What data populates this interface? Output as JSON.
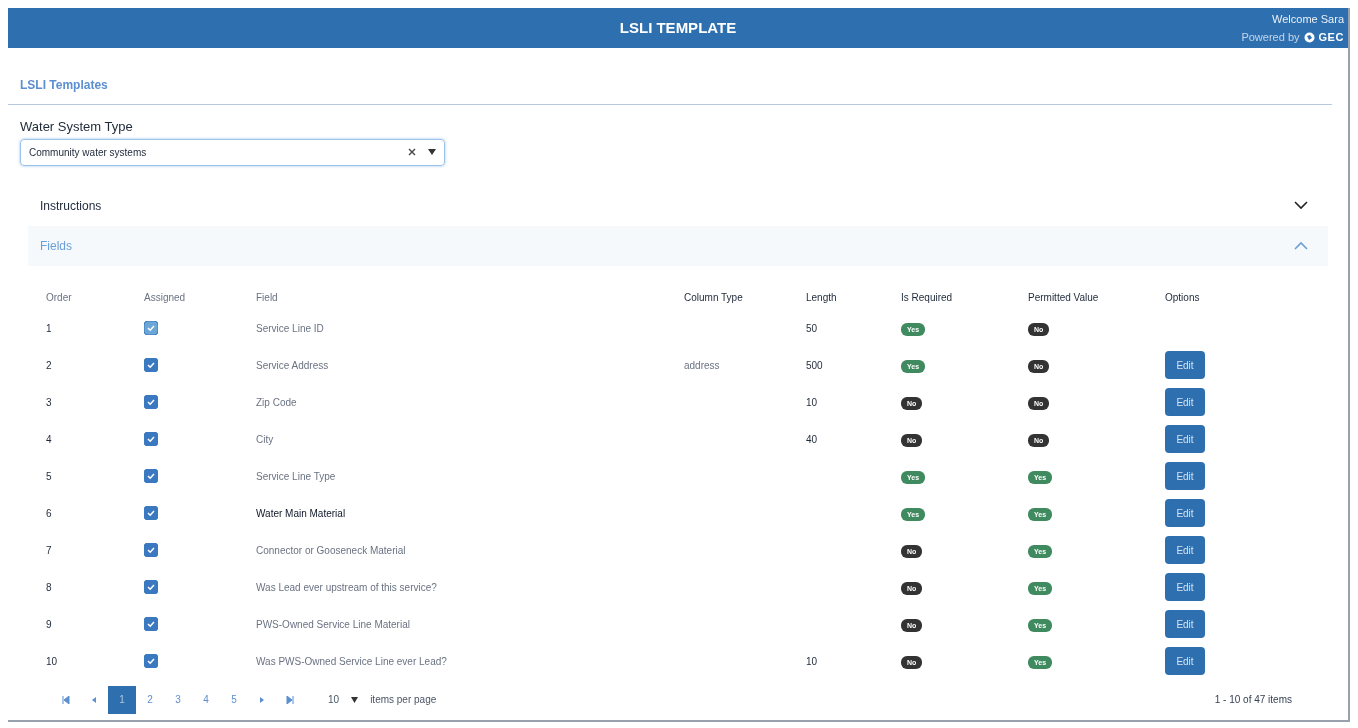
{
  "header": {
    "title": "LSLI TEMPLATE",
    "welcome": "Welcome Sara",
    "powered_by": "Powered by",
    "brand": "GEC"
  },
  "breadcrumb": "LSLI Templates",
  "water_system_type": {
    "label": "Water System Type",
    "value": "Community water systems"
  },
  "panels": [
    {
      "title": "Instructions",
      "expanded": false
    },
    {
      "title": "Fields",
      "expanded": true
    }
  ],
  "table": {
    "columns": [
      "Order",
      "Assigned",
      "Field",
      "Column Type",
      "Length",
      "Is Required",
      "Permitted Value",
      "Options"
    ],
    "rows": [
      {
        "order": "1",
        "assigned": true,
        "disabled": true,
        "field": "Service Line ID",
        "length": "50",
        "required": {
          "label": "Yes",
          "on": true
        },
        "permitted": {
          "label": "No",
          "on": false
        }
      },
      {
        "order": "2",
        "assigned": true,
        "disabled": false,
        "field": "Service Address",
        "column_type": "address",
        "length": "500",
        "required": {
          "label": "Yes",
          "on": true
        },
        "permitted": {
          "label": "No",
          "on": false
        },
        "edit": "Edit"
      },
      {
        "order": "3",
        "assigned": true,
        "disabled": false,
        "field": "Zip Code",
        "length": "10",
        "required": {
          "label": "No",
          "on": false
        },
        "permitted": {
          "label": "No",
          "on": false
        },
        "edit": "Edit"
      },
      {
        "order": "4",
        "assigned": true,
        "disabled": false,
        "field": "City",
        "length": "40",
        "required": {
          "label": "No",
          "on": false
        },
        "permitted": {
          "label": "No",
          "on": false
        },
        "edit": "Edit"
      },
      {
        "order": "5",
        "assigned": true,
        "disabled": false,
        "field": "Service Line Type",
        "required": {
          "label": "Yes",
          "on": true
        },
        "permitted": {
          "label": "Yes",
          "on": true
        },
        "edit": "Edit"
      },
      {
        "order": "6",
        "assigned": true,
        "disabled": false,
        "field": "Water Main Material",
        "required": {
          "label": "Yes",
          "on": true
        },
        "permitted": {
          "label": "Yes",
          "on": true
        },
        "edit": "Edit"
      },
      {
        "order": "7",
        "assigned": true,
        "disabled": false,
        "field": "Connector or Gooseneck Material",
        "required": {
          "label": "No",
          "on": false
        },
        "permitted": {
          "label": "Yes",
          "on": true
        },
        "edit": "Edit"
      },
      {
        "order": "8",
        "assigned": true,
        "disabled": false,
        "field": "Was Lead ever upstream of this service?",
        "required": {
          "label": "No",
          "on": false
        },
        "permitted": {
          "label": "Yes",
          "on": true
        },
        "edit": "Edit"
      },
      {
        "order": "9",
        "assigned": true,
        "disabled": false,
        "field": "PWS-Owned Service Line Material",
        "required": {
          "label": "No",
          "on": false
        },
        "permitted": {
          "label": "Yes",
          "on": true
        },
        "edit": "Edit"
      },
      {
        "order": "10",
        "assigned": true,
        "disabled": false,
        "field": "Was PWS-Owned Service Line ever Lead?",
        "length": "10",
        "required": {
          "label": "No",
          "on": false
        },
        "permitted": {
          "label": "Yes",
          "on": true
        },
        "edit": "Edit"
      }
    ]
  },
  "pager": {
    "pages": [
      {
        "label": "1",
        "selected": true
      },
      {
        "label": "2",
        "selected": false
      },
      {
        "label": "3",
        "selected": false
      },
      {
        "label": "4",
        "selected": false
      },
      {
        "label": "5",
        "selected": false
      }
    ],
    "page_size": "10",
    "page_size_label": "items per page",
    "summary": "1 - 10 of 47 items"
  }
}
